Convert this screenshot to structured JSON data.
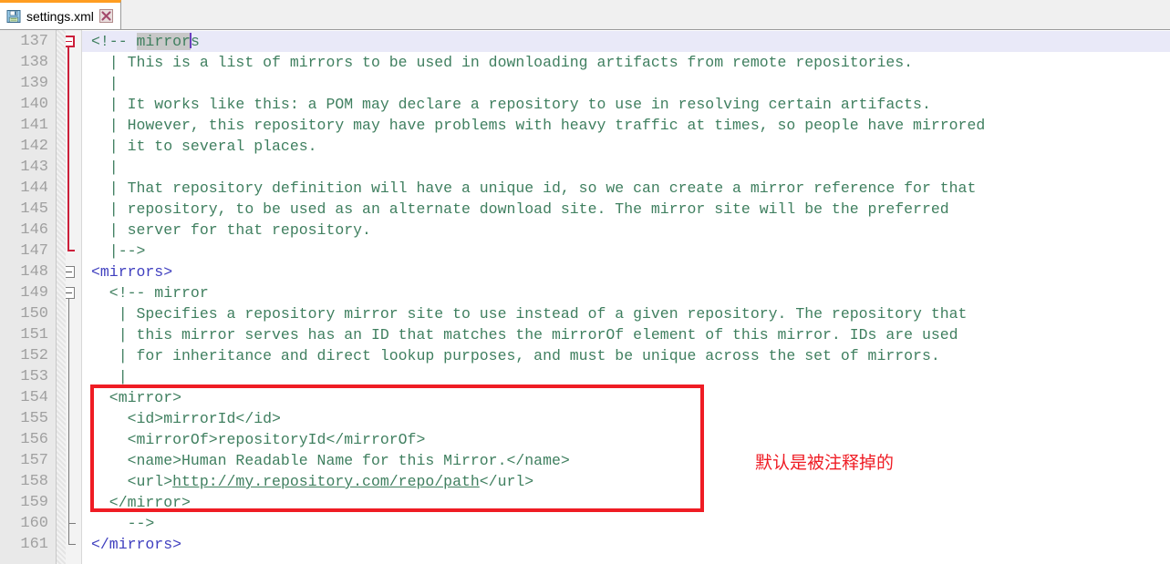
{
  "window": {
    "accent_color": "#ff9d21",
    "editor_bg": "#ffffff",
    "gutter_bg": "#e9e9e9",
    "comment_color": "#3f7f5f",
    "tag_color": "#3f3fbf",
    "annotation_color": "#ef1c24",
    "current_line_color": "#e9e9f8"
  },
  "tab": {
    "title": "settings.xml",
    "save_icon": "floppy-disk-icon",
    "close_icon": "close-icon"
  },
  "editor": {
    "first_line_number": 137,
    "line_height": 23,
    "lines": [
      {
        "n": 137,
        "text": "<!-- mirrors",
        "kind": "comment",
        "current": true,
        "selection": "mirror",
        "caret_after": "mirror"
      },
      {
        "n": 138,
        "text": "  | This is a list of mirrors to be used in downloading artifacts from remote repositories.",
        "kind": "comment"
      },
      {
        "n": 139,
        "text": "  |",
        "kind": "comment"
      },
      {
        "n": 140,
        "text": "  | It works like this: a POM may declare a repository to use in resolving certain artifacts.",
        "kind": "comment"
      },
      {
        "n": 141,
        "text": "  | However, this repository may have problems with heavy traffic at times, so people have mirrored",
        "kind": "comment"
      },
      {
        "n": 142,
        "text": "  | it to several places.",
        "kind": "comment"
      },
      {
        "n": 143,
        "text": "  |",
        "kind": "comment"
      },
      {
        "n": 144,
        "text": "  | That repository definition will have a unique id, so we can create a mirror reference for that",
        "kind": "comment"
      },
      {
        "n": 145,
        "text": "  | repository, to be used as an alternate download site. The mirror site will be the preferred",
        "kind": "comment"
      },
      {
        "n": 146,
        "text": "  | server for that repository.",
        "kind": "comment"
      },
      {
        "n": 147,
        "text": "  |-->",
        "kind": "comment"
      },
      {
        "n": 148,
        "text": "<mirrors>",
        "kind": "tag"
      },
      {
        "n": 149,
        "text": "  <!-- mirror",
        "kind": "comment"
      },
      {
        "n": 150,
        "text": "   | Specifies a repository mirror site to use instead of a given repository. The repository that",
        "kind": "comment"
      },
      {
        "n": 151,
        "text": "   | this mirror serves has an ID that matches the mirrorOf element of this mirror. IDs are used",
        "kind": "comment"
      },
      {
        "n": 152,
        "text": "   | for inheritance and direct lookup purposes, and must be unique across the set of mirrors.",
        "kind": "comment"
      },
      {
        "n": 153,
        "text": "   |",
        "kind": "comment"
      },
      {
        "n": 154,
        "text": "  <mirror>",
        "kind": "comment"
      },
      {
        "n": 155,
        "text": "    <id>mirrorId</id>",
        "kind": "comment"
      },
      {
        "n": 156,
        "text": "    <mirrorOf>repositoryId</mirrorOf>",
        "kind": "comment"
      },
      {
        "n": 157,
        "text": "    <name>Human Readable Name for this Mirror.</name>",
        "kind": "comment"
      },
      {
        "n": 158,
        "text": "    <url>http://my.repository.com/repo/path</url>",
        "kind": "comment",
        "link": "http://my.repository.com/repo/path"
      },
      {
        "n": 159,
        "text": "  </mirror>",
        "kind": "comment"
      },
      {
        "n": 160,
        "text": "    -->",
        "kind": "comment"
      },
      {
        "n": 161,
        "text": "<mirrors-close>",
        "kind": "tag",
        "display": "</mirrors>"
      }
    ],
    "fold_markers": [
      {
        "line": 137,
        "style": "red",
        "collapsible": true
      },
      {
        "line": 148,
        "style": "gray",
        "collapsible": true
      },
      {
        "line": 149,
        "style": "gray",
        "collapsible": true
      }
    ]
  },
  "annotation": {
    "note_text": "默认是被注释掉的",
    "box_label": "highlight-rectangle"
  }
}
